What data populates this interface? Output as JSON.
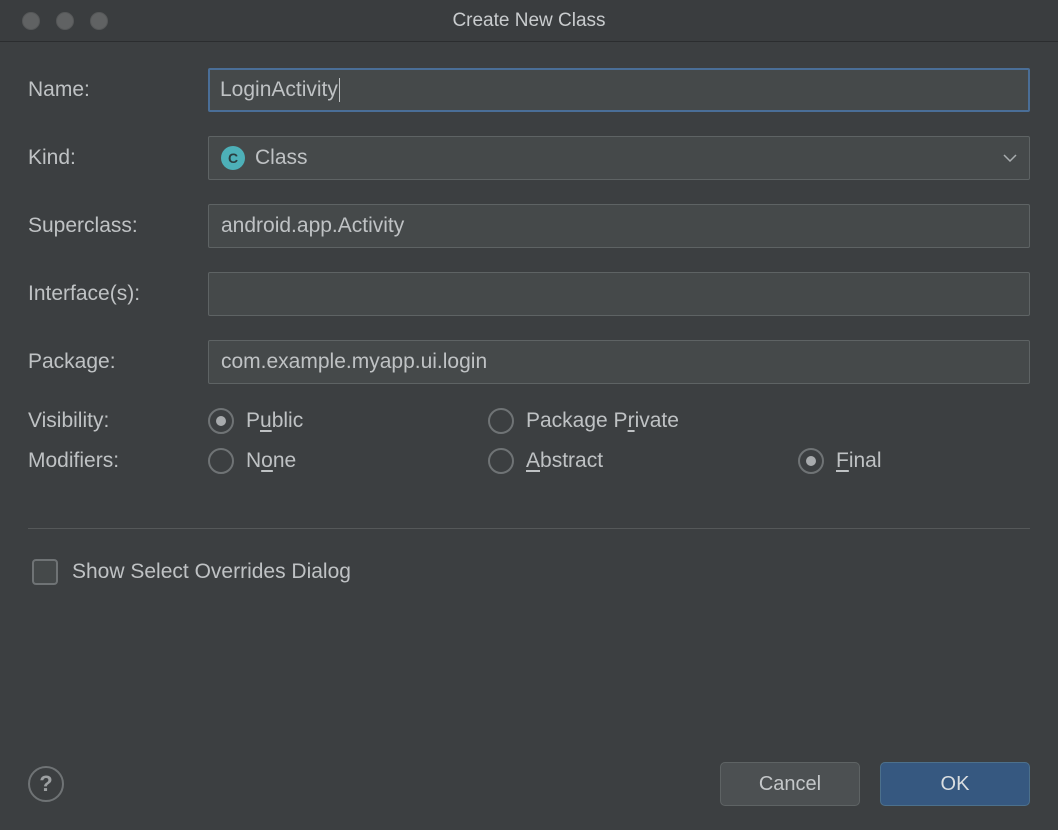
{
  "window": {
    "title": "Create New Class"
  },
  "labels": {
    "name": "Name:",
    "kind": "Kind:",
    "superclass": "Superclass:",
    "interfaces": "Interface(s):",
    "package": "Package:",
    "visibility": "Visibility:",
    "modifiers": "Modifiers:"
  },
  "fields": {
    "name": "LoginActivity",
    "kind": "Class",
    "kind_icon_letter": "C",
    "superclass": "android.app.Activity",
    "interfaces": "",
    "package": "com.example.myapp.ui.login"
  },
  "visibility": {
    "selected": "public",
    "options": {
      "public_pre": "P",
      "public_u": "u",
      "public_post": "blic",
      "pkg_pre": "Package P",
      "pkg_u": "r",
      "pkg_post": "ivate"
    }
  },
  "modifiers": {
    "selected": "final",
    "options": {
      "none_pre": "N",
      "none_u": "o",
      "none_post": "ne",
      "abstract_pre": "",
      "abstract_u": "A",
      "abstract_post": "bstract",
      "final_pre": "",
      "final_u": "F",
      "final_post": "inal"
    }
  },
  "checkbox": {
    "show_overrides": "Show Select Overrides Dialog",
    "checked": false
  },
  "buttons": {
    "help": "?",
    "cancel": "Cancel",
    "ok": "OK"
  }
}
